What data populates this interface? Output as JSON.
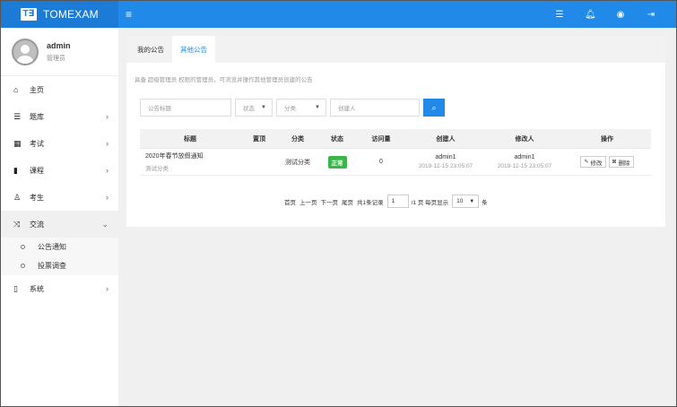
{
  "brand": {
    "logo": "T∃",
    "name": "TOMEXAM"
  },
  "topbar": {
    "icons": [
      "list-icon",
      "bell-icon",
      "user-circle-icon",
      "sign-out-icon"
    ]
  },
  "user": {
    "name": "admin",
    "role": "管理员"
  },
  "sidebar": {
    "items": [
      {
        "label": "主页",
        "icon": "home-icon"
      },
      {
        "label": "题库",
        "icon": "database-icon"
      },
      {
        "label": "考试",
        "icon": "calendar-icon"
      },
      {
        "label": "课程",
        "icon": "book-icon"
      },
      {
        "label": "考生",
        "icon": "user-icon"
      },
      {
        "label": "交流",
        "icon": "random-icon"
      },
      {
        "label": "系统",
        "icon": "mobile-icon"
      }
    ],
    "subitems": [
      {
        "label": "公告通知"
      },
      {
        "label": "投票调查"
      }
    ]
  },
  "tabs": [
    {
      "label": "我的公告"
    },
    {
      "label": "其他公告"
    }
  ],
  "description": "具备 超级管理员 权限的管理员，可浏览并操作其他管理员创建的公告",
  "filters": {
    "title_placeholder": "公告标题",
    "status": "状态",
    "category": "分类",
    "creator_placeholder": "创建人"
  },
  "table": {
    "headers": [
      "标题",
      "置顶",
      "分类",
      "状态",
      "访问量",
      "创建人",
      "修改人",
      "操作"
    ],
    "rows": [
      {
        "title": "2020年春节放假通知",
        "subtitle": "测试分类",
        "pinned": "",
        "category": "测试分类",
        "status": "正常",
        "views": "0",
        "creator": "admin1",
        "created": "2019-12-15 23:05:07",
        "modifier": "admin1",
        "modified": "2019-12-15 23:05:07",
        "edit": "修改",
        "delete": "删除"
      }
    ]
  },
  "pager": {
    "first": "首页",
    "prev": "上一页",
    "next": "下一页",
    "last": "尾页",
    "total": "共1条记录",
    "page": "1",
    "pages": "/1 页 每页显示",
    "size": "10",
    "unit": "条"
  },
  "colors": {
    "primary": "#2189e8",
    "success": "#3bb54a"
  }
}
